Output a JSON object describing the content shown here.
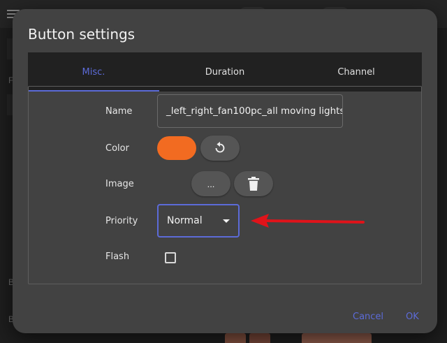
{
  "dialog": {
    "title": "Button settings",
    "tabs": [
      {
        "label": "Misc.",
        "active": true
      },
      {
        "label": "Duration",
        "active": false
      },
      {
        "label": "Channel",
        "active": false
      }
    ],
    "fields": {
      "name": {
        "label": "Name",
        "value": "_left_right_fan100pc_all moving lights"
      },
      "color": {
        "label": "Color",
        "value": "#f26b21",
        "reset_icon": "reset-icon"
      },
      "image": {
        "label": "Image",
        "browse_label": "...",
        "delete_icon": "trash-icon"
      },
      "priority": {
        "label": "Priority",
        "selected": "Normal"
      },
      "flash": {
        "label": "Flash",
        "checked": false
      }
    },
    "footer": {
      "cancel_label": "Cancel",
      "ok_label": "OK"
    }
  },
  "background": {
    "letters": [
      "F",
      "B",
      "B"
    ],
    "swatch_colors": [
      "#c97b62",
      "#b86e58",
      "#d98a72"
    ]
  },
  "annotation": {
    "arrow_color": "#e0131a"
  },
  "colors": {
    "accent": "#5c6bd8",
    "dialog_bg": "#424242",
    "tabbar_bg": "#212121"
  }
}
